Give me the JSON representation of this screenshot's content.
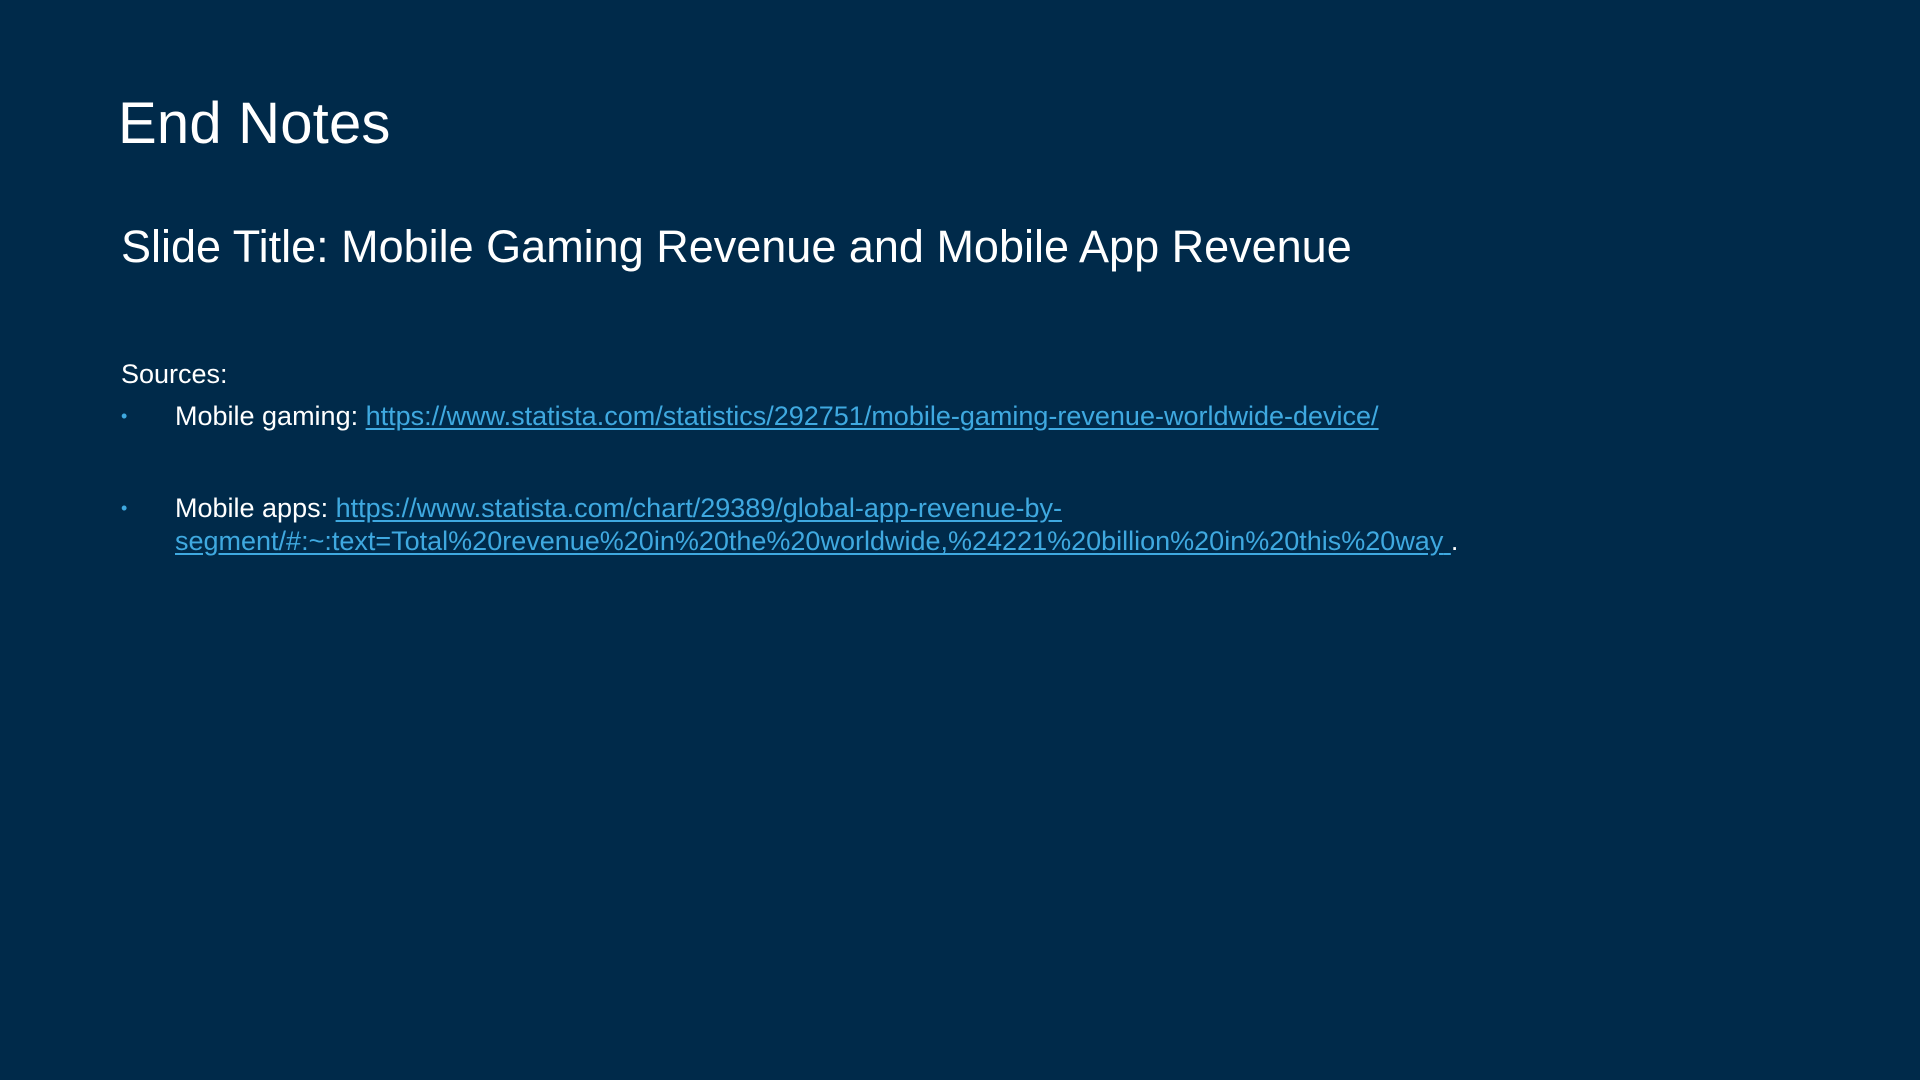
{
  "slide": {
    "title": "End Notes",
    "subtitle": "Slide Title: Mobile Gaming Revenue and Mobile App Revenue",
    "sources_label": "Sources:",
    "sources": [
      {
        "label": "Mobile gaming: ",
        "link_text": "https://www.statista.com/statistics/292751/mobile-gaming-revenue-worldwide-device/",
        "suffix": ""
      },
      {
        "label": "Mobile apps: ",
        "link_text_line_1": "https://www.statista.com/chart/29389/global-app-revenue-by-",
        "link_text_line_2": "segment/#:~:text=Total%20revenue%20in%20the%20worldwide,%24221%20billion%20in%20this%20way",
        "suffix": "."
      }
    ]
  },
  "colors": {
    "background": "#002a4a",
    "text": "#ffffff",
    "link": "#3fa9e0",
    "bullet": "#3fa9e0"
  },
  "icons": {
    "bullet": "bullet-dot-icon"
  }
}
